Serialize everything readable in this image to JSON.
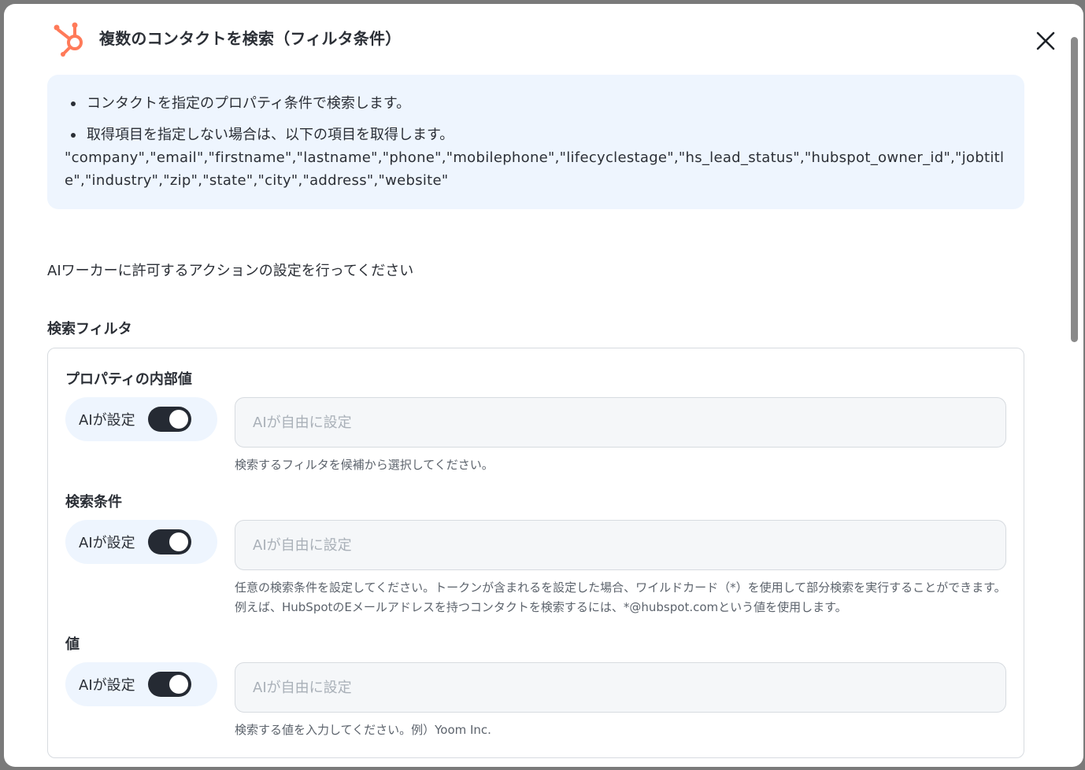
{
  "modal": {
    "title": "複数のコンタクトを検索（フィルタ条件）",
    "close_icon": "close-icon",
    "logo_icon": "hubspot-logo-icon",
    "brand_color": "#ff7a59"
  },
  "info": {
    "bullet1": "コンタクトを指定のプロパティ条件で検索します。",
    "bullet2": "取得項目を指定しない場合は、以下の項目を取得します。",
    "fields": "\"company\",\"email\",\"firstname\",\"lastname\",\"phone\",\"mobilephone\",\"lifecyclestage\",\"hs_lead_status\",\"hubspot_owner_id\",\"jobtitle\",\"industry\",\"zip\",\"state\",\"city\",\"address\",\"website\""
  },
  "instruction": "AIワーカーに許可するアクションの設定を行ってください",
  "section_title": "検索フィルタ",
  "filters": [
    {
      "label": "プロパティの内部値",
      "toggle_label": "AIが設定",
      "toggle_on": true,
      "placeholder": "AIが自由に設定",
      "help": "検索するフィルタを候補から選択してください。"
    },
    {
      "label": "検索条件",
      "toggle_label": "AIが設定",
      "toggle_on": true,
      "placeholder": "AIが自由に設定",
      "help": "任意の検索条件を設定してください。トークンが含まれるを設定した場合、ワイルドカード（*）を使用して部分検索を実行することができます。例えば、HubSpotのEメールアドレスを持つコンタクトを検索するには、*@hubspot.comという値を使用します。"
    },
    {
      "label": "値",
      "toggle_label": "AIが設定",
      "toggle_on": true,
      "placeholder": "AIが自由に設定",
      "help": "検索する値を入力してください。例）Yoom Inc."
    }
  ]
}
